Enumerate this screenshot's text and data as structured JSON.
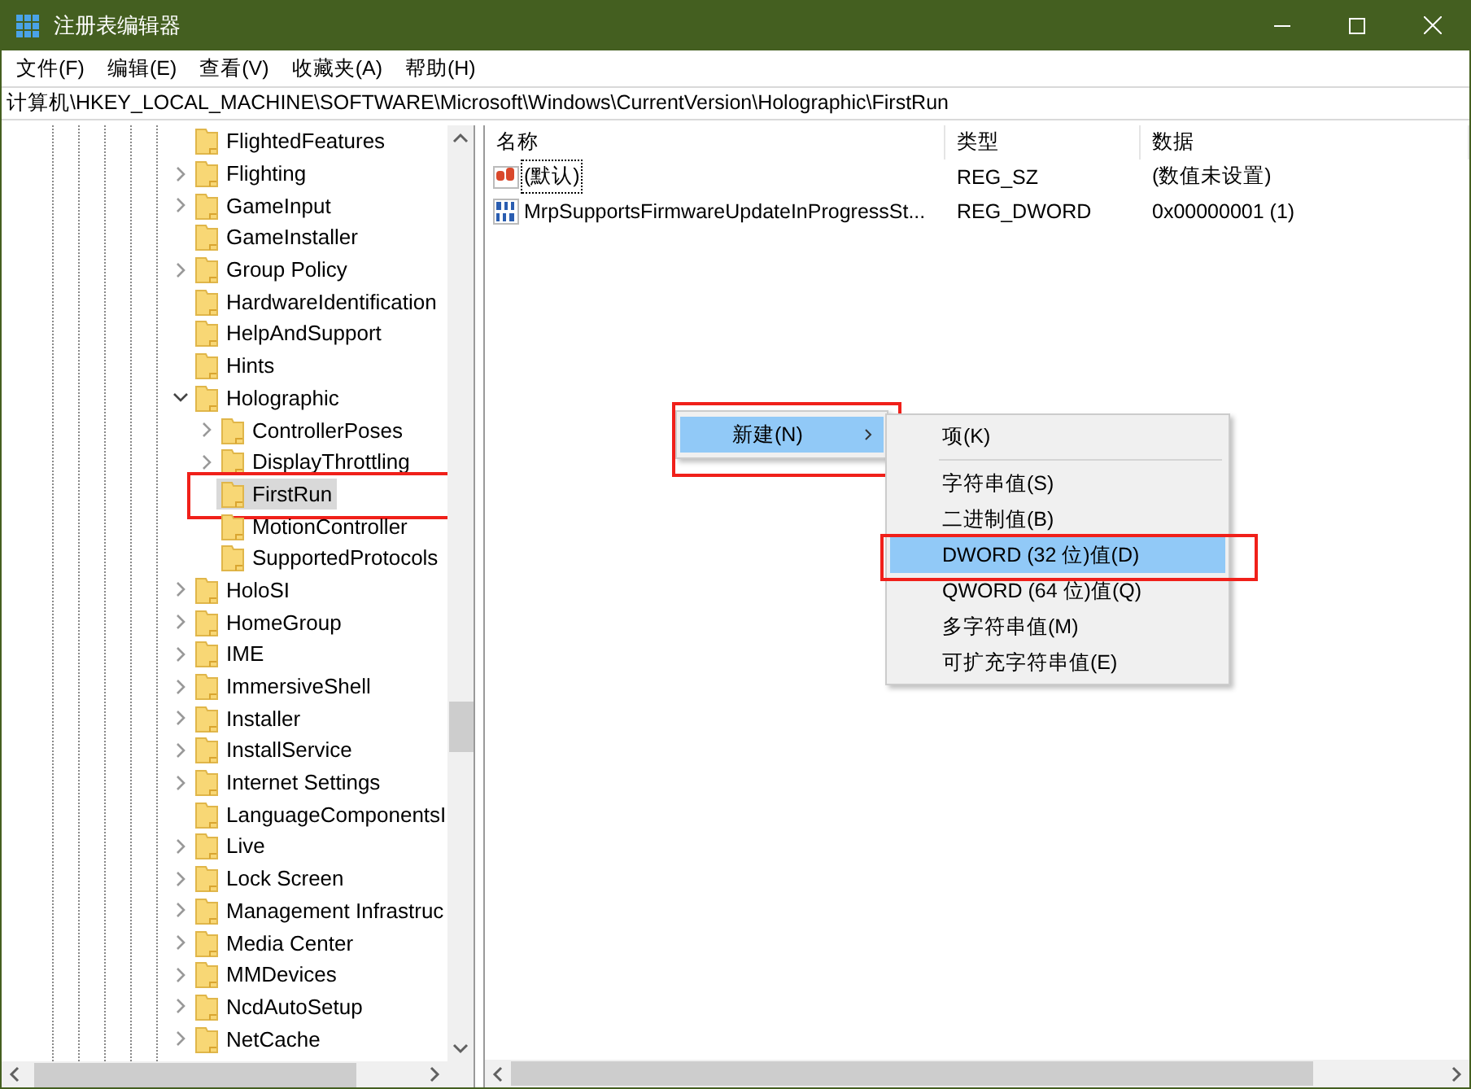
{
  "window": {
    "title": "注册表编辑器"
  },
  "menu": [
    "文件(F)",
    "编辑(E)",
    "查看(V)",
    "收藏夹(A)",
    "帮助(H)"
  ],
  "address": "计算机\\HKEY_LOCAL_MACHINE\\SOFTWARE\\Microsoft\\Windows\\CurrentVersion\\Holographic\\FirstRun",
  "tree": [
    {
      "label": "FlightedFeatures",
      "expandable": false,
      "selected": false,
      "outlined": false
    },
    {
      "label": "Flighting",
      "expandable": true,
      "selected": false,
      "outlined": false
    },
    {
      "label": "GameInput",
      "expandable": true,
      "selected": false,
      "outlined": false
    },
    {
      "label": "GameInstaller",
      "expandable": false,
      "selected": false,
      "outlined": false
    },
    {
      "label": "Group Policy",
      "expandable": true,
      "selected": false,
      "outlined": false
    },
    {
      "label": "HardwareIdentification",
      "expandable": false,
      "selected": false,
      "outlined": false
    },
    {
      "label": "HelpAndSupport",
      "expandable": false,
      "selected": false,
      "outlined": false
    },
    {
      "label": "Hints",
      "expandable": false,
      "selected": false,
      "outlined": false
    },
    {
      "label": "Holographic",
      "expandable": true,
      "expanded": true,
      "selected": false,
      "outlined": false,
      "children": [
        {
          "label": "ControllerPoses",
          "expandable": true,
          "selected": false,
          "outlined": false
        },
        {
          "label": "DisplayThrottling",
          "expandable": true,
          "selected": false,
          "outlined": false
        },
        {
          "label": "FirstRun",
          "expandable": false,
          "selected": true,
          "outlined": true
        },
        {
          "label": "MotionController",
          "expandable": false,
          "selected": false,
          "outlined": false
        },
        {
          "label": "SupportedProtocols",
          "expandable": false,
          "selected": false,
          "outlined": false
        }
      ]
    },
    {
      "label": "HoloSI",
      "expandable": true,
      "selected": false,
      "outlined": false
    },
    {
      "label": "HomeGroup",
      "expandable": true,
      "selected": false,
      "outlined": false
    },
    {
      "label": "IME",
      "expandable": true,
      "selected": false,
      "outlined": false
    },
    {
      "label": "ImmersiveShell",
      "expandable": true,
      "selected": false,
      "outlined": false
    },
    {
      "label": "Installer",
      "expandable": true,
      "selected": false,
      "outlined": false
    },
    {
      "label": "InstallService",
      "expandable": true,
      "selected": false,
      "outlined": false
    },
    {
      "label": "Internet Settings",
      "expandable": true,
      "selected": false,
      "outlined": false
    },
    {
      "label": "LanguageComponentsI",
      "expandable": false,
      "selected": false,
      "outlined": false
    },
    {
      "label": "Live",
      "expandable": true,
      "selected": false,
      "outlined": false
    },
    {
      "label": "Lock Screen",
      "expandable": true,
      "selected": false,
      "outlined": false
    },
    {
      "label": "Management Infrastruc",
      "expandable": true,
      "selected": false,
      "outlined": false
    },
    {
      "label": "Media Center",
      "expandable": true,
      "selected": false,
      "outlined": false
    },
    {
      "label": "MMDevices",
      "expandable": true,
      "selected": false,
      "outlined": false
    },
    {
      "label": "NcdAutoSetup",
      "expandable": true,
      "selected": false,
      "outlined": false
    },
    {
      "label": "NetCache",
      "expandable": true,
      "selected": false,
      "outlined": false
    }
  ],
  "values": {
    "columns": [
      "名称",
      "类型",
      "数据"
    ],
    "rows": [
      {
        "kind": "string",
        "name": "(默认)",
        "type": "REG_SZ",
        "data": "(数值未设置)",
        "focused": true
      },
      {
        "kind": "dword",
        "name": "MrpSupportsFirmwareUpdateInProgressSt...",
        "type": "REG_DWORD",
        "data": "0x00000001 (1)",
        "focused": false
      }
    ]
  },
  "context_menu": {
    "items": [
      {
        "label": "新建(N)",
        "submenu": true,
        "selected": true,
        "outlined": true
      }
    ],
    "submenu": [
      {
        "kind": "item",
        "label": "项(K)",
        "selected": false,
        "outlined": false
      },
      {
        "kind": "separator"
      },
      {
        "kind": "item",
        "label": "字符串值(S)",
        "selected": false,
        "outlined": false
      },
      {
        "kind": "item",
        "label": "二进制值(B)",
        "selected": false,
        "outlined": false
      },
      {
        "kind": "item",
        "label": "DWORD (32 位)值(D)",
        "selected": true,
        "outlined": true
      },
      {
        "kind": "item",
        "label": "QWORD (64 位)值(Q)",
        "selected": false,
        "outlined": false
      },
      {
        "kind": "item",
        "label": "多字符串值(M)",
        "selected": false,
        "outlined": false
      },
      {
        "kind": "item",
        "label": "可扩充字符串值(E)",
        "selected": false,
        "outlined": false
      }
    ]
  }
}
